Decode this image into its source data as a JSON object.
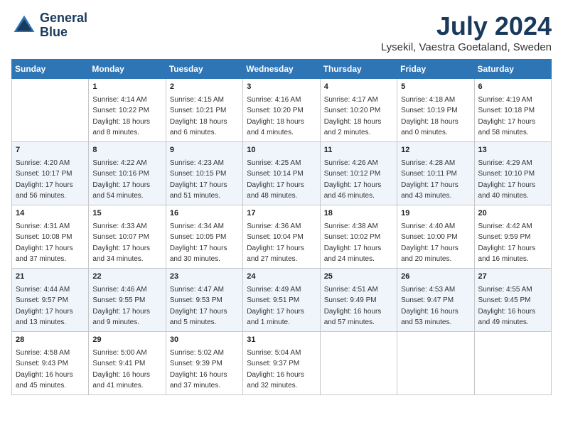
{
  "header": {
    "logo_line1": "General",
    "logo_line2": "Blue",
    "month_year": "July 2024",
    "location": "Lysekil, Vaestra Goetaland, Sweden"
  },
  "days_of_week": [
    "Sunday",
    "Monday",
    "Tuesday",
    "Wednesday",
    "Thursday",
    "Friday",
    "Saturday"
  ],
  "weeks": [
    [
      {
        "day": "",
        "info": ""
      },
      {
        "day": "1",
        "info": "Sunrise: 4:14 AM\nSunset: 10:22 PM\nDaylight: 18 hours\nand 8 minutes."
      },
      {
        "day": "2",
        "info": "Sunrise: 4:15 AM\nSunset: 10:21 PM\nDaylight: 18 hours\nand 6 minutes."
      },
      {
        "day": "3",
        "info": "Sunrise: 4:16 AM\nSunset: 10:20 PM\nDaylight: 18 hours\nand 4 minutes."
      },
      {
        "day": "4",
        "info": "Sunrise: 4:17 AM\nSunset: 10:20 PM\nDaylight: 18 hours\nand 2 minutes."
      },
      {
        "day": "5",
        "info": "Sunrise: 4:18 AM\nSunset: 10:19 PM\nDaylight: 18 hours\nand 0 minutes."
      },
      {
        "day": "6",
        "info": "Sunrise: 4:19 AM\nSunset: 10:18 PM\nDaylight: 17 hours\nand 58 minutes."
      }
    ],
    [
      {
        "day": "7",
        "info": "Sunrise: 4:20 AM\nSunset: 10:17 PM\nDaylight: 17 hours\nand 56 minutes."
      },
      {
        "day": "8",
        "info": "Sunrise: 4:22 AM\nSunset: 10:16 PM\nDaylight: 17 hours\nand 54 minutes."
      },
      {
        "day": "9",
        "info": "Sunrise: 4:23 AM\nSunset: 10:15 PM\nDaylight: 17 hours\nand 51 minutes."
      },
      {
        "day": "10",
        "info": "Sunrise: 4:25 AM\nSunset: 10:14 PM\nDaylight: 17 hours\nand 48 minutes."
      },
      {
        "day": "11",
        "info": "Sunrise: 4:26 AM\nSunset: 10:12 PM\nDaylight: 17 hours\nand 46 minutes."
      },
      {
        "day": "12",
        "info": "Sunrise: 4:28 AM\nSunset: 10:11 PM\nDaylight: 17 hours\nand 43 minutes."
      },
      {
        "day": "13",
        "info": "Sunrise: 4:29 AM\nSunset: 10:10 PM\nDaylight: 17 hours\nand 40 minutes."
      }
    ],
    [
      {
        "day": "14",
        "info": "Sunrise: 4:31 AM\nSunset: 10:08 PM\nDaylight: 17 hours\nand 37 minutes."
      },
      {
        "day": "15",
        "info": "Sunrise: 4:33 AM\nSunset: 10:07 PM\nDaylight: 17 hours\nand 34 minutes."
      },
      {
        "day": "16",
        "info": "Sunrise: 4:34 AM\nSunset: 10:05 PM\nDaylight: 17 hours\nand 30 minutes."
      },
      {
        "day": "17",
        "info": "Sunrise: 4:36 AM\nSunset: 10:04 PM\nDaylight: 17 hours\nand 27 minutes."
      },
      {
        "day": "18",
        "info": "Sunrise: 4:38 AM\nSunset: 10:02 PM\nDaylight: 17 hours\nand 24 minutes."
      },
      {
        "day": "19",
        "info": "Sunrise: 4:40 AM\nSunset: 10:00 PM\nDaylight: 17 hours\nand 20 minutes."
      },
      {
        "day": "20",
        "info": "Sunrise: 4:42 AM\nSunset: 9:59 PM\nDaylight: 17 hours\nand 16 minutes."
      }
    ],
    [
      {
        "day": "21",
        "info": "Sunrise: 4:44 AM\nSunset: 9:57 PM\nDaylight: 17 hours\nand 13 minutes."
      },
      {
        "day": "22",
        "info": "Sunrise: 4:46 AM\nSunset: 9:55 PM\nDaylight: 17 hours\nand 9 minutes."
      },
      {
        "day": "23",
        "info": "Sunrise: 4:47 AM\nSunset: 9:53 PM\nDaylight: 17 hours\nand 5 minutes."
      },
      {
        "day": "24",
        "info": "Sunrise: 4:49 AM\nSunset: 9:51 PM\nDaylight: 17 hours\nand 1 minute."
      },
      {
        "day": "25",
        "info": "Sunrise: 4:51 AM\nSunset: 9:49 PM\nDaylight: 16 hours\nand 57 minutes."
      },
      {
        "day": "26",
        "info": "Sunrise: 4:53 AM\nSunset: 9:47 PM\nDaylight: 16 hours\nand 53 minutes."
      },
      {
        "day": "27",
        "info": "Sunrise: 4:55 AM\nSunset: 9:45 PM\nDaylight: 16 hours\nand 49 minutes."
      }
    ],
    [
      {
        "day": "28",
        "info": "Sunrise: 4:58 AM\nSunset: 9:43 PM\nDaylight: 16 hours\nand 45 minutes."
      },
      {
        "day": "29",
        "info": "Sunrise: 5:00 AM\nSunset: 9:41 PM\nDaylight: 16 hours\nand 41 minutes."
      },
      {
        "day": "30",
        "info": "Sunrise: 5:02 AM\nSunset: 9:39 PM\nDaylight: 16 hours\nand 37 minutes."
      },
      {
        "day": "31",
        "info": "Sunrise: 5:04 AM\nSunset: 9:37 PM\nDaylight: 16 hours\nand 32 minutes."
      },
      {
        "day": "",
        "info": ""
      },
      {
        "day": "",
        "info": ""
      },
      {
        "day": "",
        "info": ""
      }
    ]
  ]
}
